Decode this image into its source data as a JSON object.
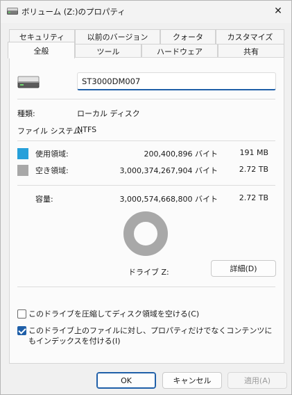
{
  "window": {
    "title": "ボリューム (Z:)のプロパティ",
    "close_glyph": "✕"
  },
  "tabs_top": [
    "セキュリティ",
    "以前のバージョン",
    "クォータ",
    "カスタマイズ"
  ],
  "tabs_bottom": [
    "全般",
    "ツール",
    "ハードウェア",
    "共有"
  ],
  "active_tab": "全般",
  "general": {
    "volume_name": "ST3000DM007",
    "type_label": "種類:",
    "type_value": "ローカル ディスク",
    "fs_label": "ファイル システム:",
    "fs_value": "NTFS",
    "used_label": "使用領域:",
    "used_bytes": "200,400,896 バイト",
    "used_size": "191 MB",
    "free_label": "空き領域:",
    "free_bytes": "3,000,374,267,904 バイト",
    "free_size": "2.72 TB",
    "capacity_label": "容量:",
    "capacity_bytes": "3,000,574,668,800 バイト",
    "capacity_size": "2.72 TB",
    "drive_label": "ドライブ Z:",
    "details_button": "詳細(D)",
    "used_fraction": 6.68e-05,
    "used_color": "#26a0da",
    "free_color": "#a8a8a8"
  },
  "options": {
    "compress_label": "このドライブを圧縮してディスク領域を空ける(C)",
    "compress_checked": false,
    "index_label": "このドライブ上のファイルに対し、プロパティだけでなくコンテンツにもインデックスを付ける(I)",
    "index_checked": true
  },
  "footer": {
    "ok": "OK",
    "cancel": "キャンセル",
    "apply": "適用(A)"
  }
}
